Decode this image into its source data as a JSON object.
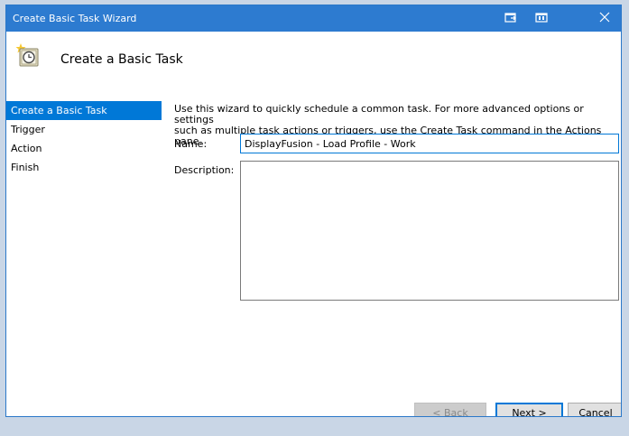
{
  "window": {
    "title": "Create Basic Task Wizard"
  },
  "header": {
    "title": "Create a Basic Task",
    "icon": "task-scheduler-clock-icon"
  },
  "nav": {
    "items": [
      {
        "label": "Create a Basic Task",
        "active": true
      },
      {
        "label": "Trigger",
        "active": false
      },
      {
        "label": "Action",
        "active": false
      },
      {
        "label": "Finish",
        "active": false
      }
    ]
  },
  "content": {
    "intro_line1": "Use this wizard to quickly schedule a common task.  For more advanced options or settings",
    "intro_line2": "such as multiple task actions or triggers, use the Create Task command in the Actions pane.",
    "name_label": "Name:",
    "name_value": "DisplayFusion - Load Profile - Work",
    "description_label": "Description:",
    "description_value": ""
  },
  "buttons": {
    "back": "< Back",
    "next": "Next >",
    "cancel": "Cancel"
  },
  "colors": {
    "titlebar": "#2d7bd0",
    "selection": "#0078d7",
    "desktop": "#c9d6e6"
  }
}
